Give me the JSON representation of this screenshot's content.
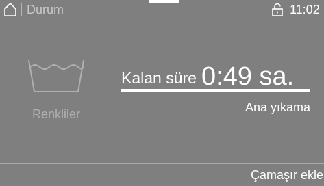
{
  "status_bar": {
    "home_icon": "home-icon",
    "title": "Durum",
    "lock_icon": "lock-icon",
    "time": "11:02"
  },
  "program": {
    "icon": "wash-tub-icon",
    "name": "Renkliler"
  },
  "remaining": {
    "label": "Kalan süre",
    "value": "0:49 sa.",
    "progress_percent": 100
  },
  "phase": "Ana yıkama",
  "actions": {
    "add_laundry_label": "Çamaşır ekle"
  },
  "colors": {
    "background": "#7f7f7f",
    "text": "#ffffff",
    "muted_text": "#b0b0b0"
  }
}
